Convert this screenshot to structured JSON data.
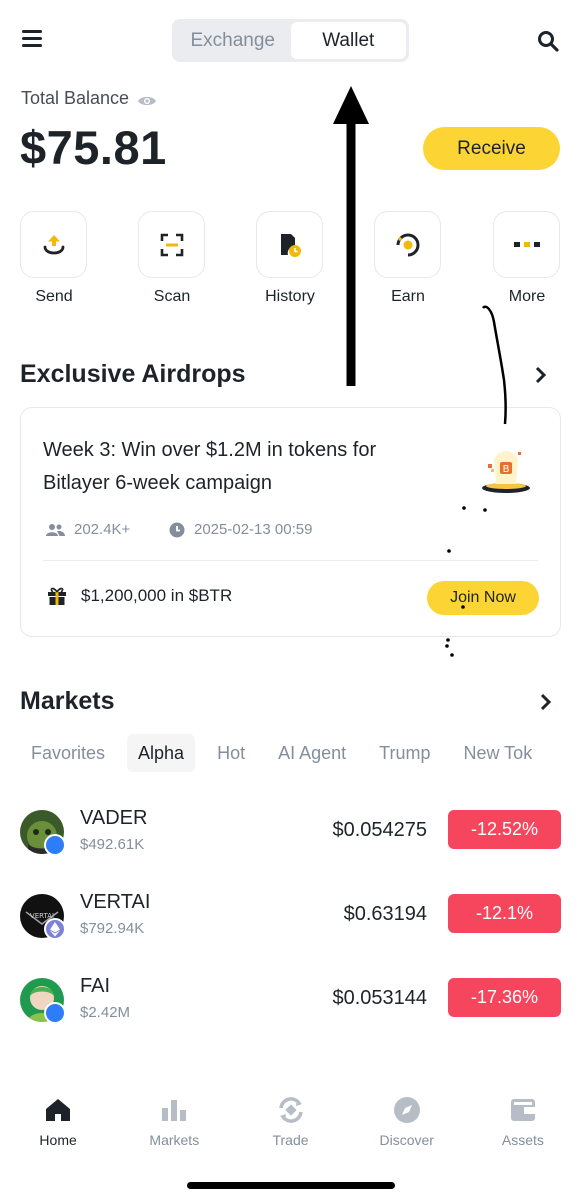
{
  "header": {
    "segments": [
      "Exchange",
      "Wallet"
    ],
    "active_segment": "Wallet"
  },
  "balance": {
    "label": "Total Balance",
    "value": "$75.81",
    "receive_label": "Receive"
  },
  "quick_actions": [
    {
      "label": "Send",
      "icon": "send-icon"
    },
    {
      "label": "Scan",
      "icon": "scan-icon"
    },
    {
      "label": "History",
      "icon": "history-icon"
    },
    {
      "label": "Earn",
      "icon": "earn-icon"
    },
    {
      "label": "More",
      "icon": "more-icon"
    }
  ],
  "airdrops": {
    "title": "Exclusive Airdrops",
    "card": {
      "title": "Week 3: Win over $1.2M in tokens for Bitlayer 6-week campaign",
      "participants": "202.4K+",
      "date": "2025-02-13 00:59",
      "reward": "$1,200,000 in $BTR",
      "join_label": "Join Now"
    }
  },
  "markets": {
    "title": "Markets",
    "tabs": [
      "Favorites",
      "Alpha",
      "Hot",
      "AI Agent",
      "Trump",
      "New Tok"
    ],
    "active_tab": "Alpha",
    "rows": [
      {
        "name": "VADER",
        "volume": "$492.61K",
        "price": "$0.054275",
        "change": "-12.52%"
      },
      {
        "name": "VERTAI",
        "volume": "$792.94K",
        "price": "$0.63194",
        "change": "-12.1%"
      },
      {
        "name": "FAI",
        "volume": "$2.42M",
        "price": "$0.053144",
        "change": "-17.36%"
      }
    ]
  },
  "bottom_nav": [
    {
      "label": "Home",
      "icon": "home-icon",
      "active": true
    },
    {
      "label": "Markets",
      "icon": "markets-icon",
      "active": false
    },
    {
      "label": "Trade",
      "icon": "trade-icon",
      "active": false
    },
    {
      "label": "Discover",
      "icon": "discover-icon",
      "active": false
    },
    {
      "label": "Assets",
      "icon": "assets-icon",
      "active": false
    }
  ],
  "colors": {
    "accent": "#fcd535",
    "negative": "#f6465d",
    "text_primary": "#1e2329",
    "text_secondary": "#848e9c"
  }
}
